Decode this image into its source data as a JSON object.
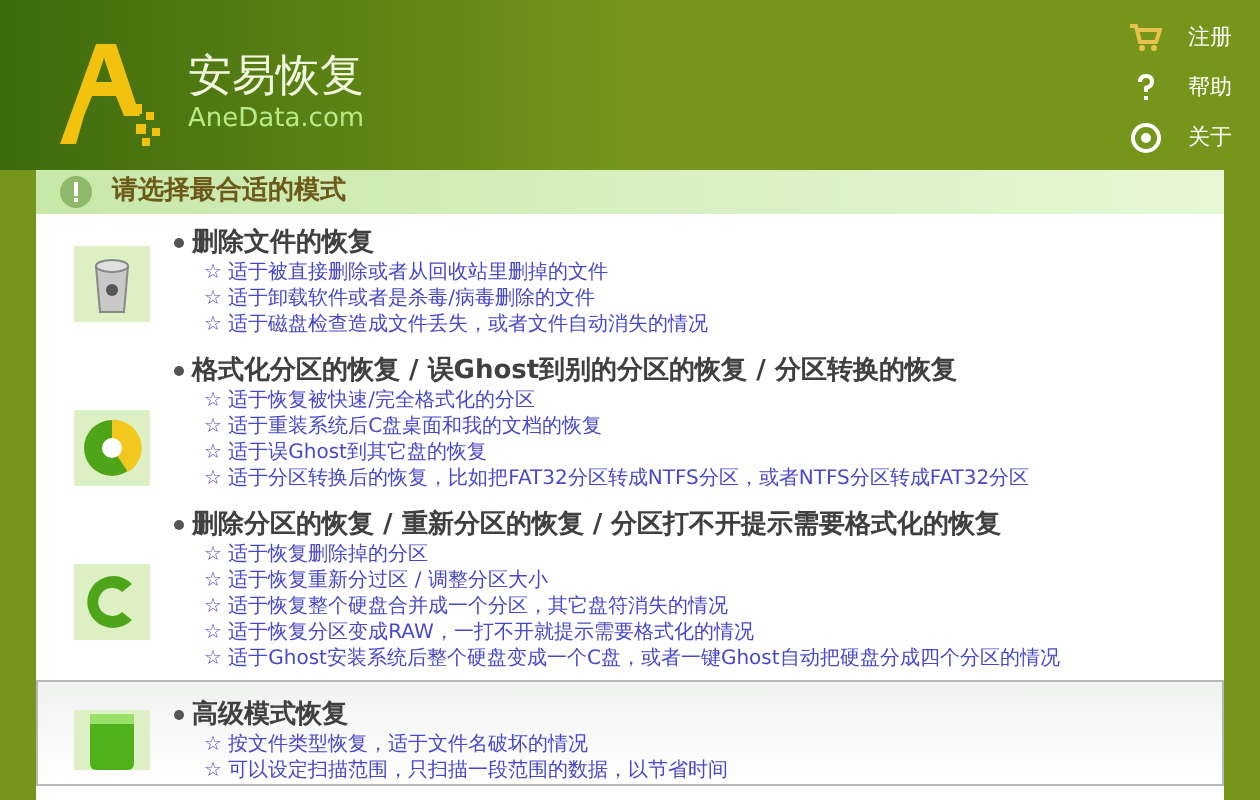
{
  "app": {
    "name": "安易恢复",
    "site": "AneData.com"
  },
  "top_links": [
    {
      "kind": "cart",
      "label": "注册"
    },
    {
      "kind": "help",
      "label": "帮助"
    },
    {
      "kind": "about",
      "label": "关于"
    }
  ],
  "banner": "请选择最合适的模式",
  "modes": [
    {
      "kind": "trash",
      "title": "删除文件的恢复",
      "selected": false,
      "items": [
        "☆ 适于被直接删除或者从回收站里删掉的文件",
        "☆ 适于卸载软件或者是杀毒/病毒删除的文件",
        "☆ 适于磁盘检查造成文件丢失，或者文件自动消失的情况"
      ]
    },
    {
      "kind": "pie",
      "title": "格式化分区的恢复 / 误Ghost到别的分区的恢复 / 分区转换的恢复",
      "selected": false,
      "items": [
        "☆ 适于恢复被快速/完全格式化的分区",
        "☆ 适于重装系统后C盘桌面和我的文档的恢复",
        "☆ 适于误Ghost到其它盘的恢复",
        "☆ 适于分区转换后的恢复，比如把FAT32分区转成NTFS分区，或者NTFS分区转成FAT32分区"
      ]
    },
    {
      "kind": "ring",
      "title": "删除分区的恢复 / 重新分区的恢复 / 分区打不开提示需要格式化的恢复",
      "selected": false,
      "items": [
        "☆ 适于恢复删除掉的分区",
        "☆ 适于恢复重新分过区 / 调整分区大小",
        "☆ 适于恢复整个硬盘合并成一个分区，其它盘符消失的情况",
        "☆ 适于恢复分区变成RAW，一打不开就提示需要格式化的情况",
        "☆ 适于Ghost安装系统后整个硬盘变成一个C盘，或者一键Ghost自动把硬盘分成四个分区的情况"
      ]
    },
    {
      "kind": "battery",
      "title": "高级模式恢复",
      "selected": true,
      "items": [
        "☆ 按文件类型恢复，适于文件名破坏的情况",
        "☆ 可以设定扫描范围，只扫描一段范围的数据，以节省时间"
      ]
    }
  ]
}
